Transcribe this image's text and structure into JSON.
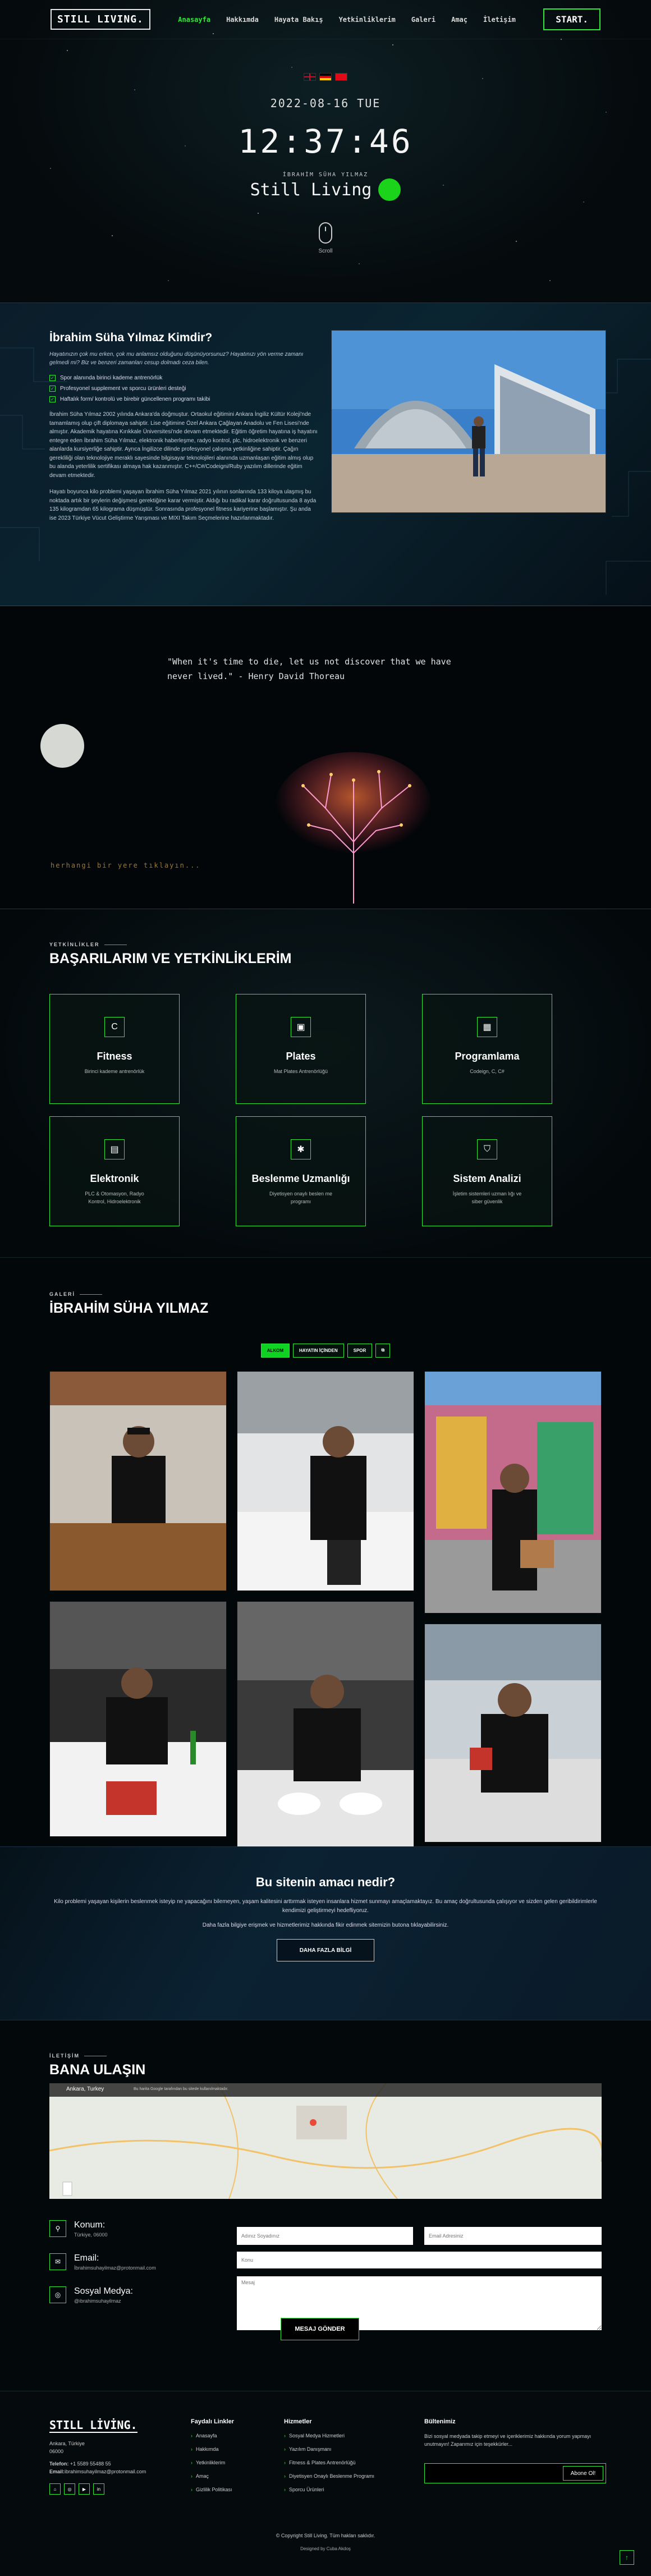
{
  "header": {
    "logo": "STILL LIVING.",
    "nav": [
      "Anasayfa",
      "Hakkımda",
      "Hayata Bakış",
      "Yetkinliklerim",
      "Galeri",
      "Amaç",
      "İletişim"
    ],
    "start": "START."
  },
  "hero": {
    "date": "2022-08-16 TUE",
    "time": "12:37:46",
    "name": "İBRAHİM SÜHA YILMAZ",
    "tagline": "Still Living",
    "scroll": "Scroll"
  },
  "about": {
    "title": "İbrahim Süha Yılmaz Kimdir?",
    "lead": "Hayatınızın çok mu erken, çok mu anlamsız olduğunu düşünüyorsunuz? Hayatınızı yön verme zamanı gelmedi mi? Biz ve benzeri zamanları cesup dolmadı ceza bilen.",
    "checks": [
      "Spor alanında birinci kademe antrenörlük",
      "Profesyonel supplement ve sporcu ürünleri desteği",
      "Haftalık form/ kontrolü ve birebir güncellenen programı takibi"
    ],
    "p1": "İbrahim Süha Yılmaz 2002 yılında Ankara'da doğmuştur. Ortaokul eğitimini Ankara İngiliz Kültür Koleji'nde tamamlamış olup çift diplomaya sahiptir. Lise eğitimine Özel Ankara Çağlayan Anadolu ve Fen Lisesi'nde almıştır. Akademik hayatına Kırıkkale Üniversitesi'nde devam etmektedir. Eğitim öğretim hayatına iş hayatını entegre eden İbrahim Süha Yılmaz, elektronik haberleşme, radyo kontrol, plc, hidroelektronik ve benzeri alanlarda kursiyerliğe sahiptir. Ayrıca İngilizce dilinde profesyonel çalışma yetkinliğine sahiptir. Çağın gerekliliği olan teknolojiye meraklı sayesinde bilgisayar teknolojileri alanında uzmanlaşan eğitim almış olup bu alanda yeterlilik sertifikası almaya hak kazanmıştır. C++/C#/Codeigni/Ruby yazılım dillerinde eğitim devam etmektedir.",
    "p2": "Hayatı boyunca kilo problemi yaşayan İbrahim Süha Yılmaz 2021 yılının sonlarında 133 kiloya ulaşmış bu noktada artık bir şeylerin değişmesi gerektiğine karar vermiştir. Aldığı bu radikal karar doğrultusunda 8 ayda 135 kilogramdan 65 kilograma düşmüştür. Sonrasında profesyonel fitness kariyerine başlamıştır. Şu anda ise 2023 Türkiye Vücut Geliştirme Yarışması ve MIXI Takım Seçmelerine hazırlanmaktadır."
  },
  "quote": {
    "text": "\"When it's time to die, let us not discover that we have never lived.\" - Henry David Thoreau",
    "hint": "herhangi bir yere tıklayın..."
  },
  "skills": {
    "kicker": "YETKİNLİKLER",
    "title": "BAŞARILARIM VE YETKİNLİKLERİM",
    "cards": [
      {
        "icon": "C",
        "title": "Fitness",
        "desc": "Birinci kademe antrenörlük"
      },
      {
        "icon": "▣",
        "title": "Plates",
        "desc": "Mat Plates Antrenörlüğü"
      },
      {
        "icon": "▦",
        "title": "Programlama",
        "desc": "Codeign, C, C#"
      },
      {
        "icon": "▤",
        "title": "Elektronik",
        "desc": "PLC & Otomasyon, Radyo Kontrol, Hidroelektronik"
      },
      {
        "icon": "✱",
        "title": "Beslenme Uzmanlığı",
        "desc": "Diyetisyen onaylı beslen me programı"
      },
      {
        "icon": "⛉",
        "title": "Sistem Analizi",
        "desc": "İşletim sistemleri uzman lığı ve siber güvenlik"
      }
    ]
  },
  "gallery": {
    "kicker": "GALERİ",
    "title": "İBRAHİM SÜHA YILMAZ",
    "tabs": [
      "ALKOM",
      "HAYATIN İÇİNDEN",
      "SPOR",
      "⧉"
    ]
  },
  "mission": {
    "title": "Bu sitenin amacı nedir?",
    "p1": "Kilo problemi yaşayan kişilerin beslenmek isteyip ne yapacağını bilemeyen, yaşam kalitesini arttırmak isteyen insanlara hizmet sunmayı amaçlamaktayız. Bu amaç doğrultusunda çalışıyor ve sizden gelen geribildirimlerle kendimizi geliştirmeyi hedefliyoruz.",
    "p2": "Daha fazla bilgiye erişmek ve hizmetlerimiz hakkında fikir edinmek sitemizin butona tıklayabilirsiniz.",
    "btn": "DAHA FAZLA BİLGİ"
  },
  "contact": {
    "kicker": "İLETİŞİM",
    "title": "BANA ULAŞIN",
    "map_place": "Ankara, Turkey",
    "map_sub": "Bu harita Google tarafından bu sitede kullanılmaktadır.",
    "items": [
      {
        "icon": "⚲",
        "label": "Konum:",
        "value": "Türkiye, 06000"
      },
      {
        "icon": "✉",
        "label": "Email:",
        "value": "İbrahimsuhayilmaz@protonmail.com"
      },
      {
        "icon": "◎",
        "label": "Sosyal Medya:",
        "value": "@ibrahimsuhayilmaz"
      }
    ],
    "ph_name": "Adınız Soyadınız",
    "ph_email": "Email Adresiniz",
    "ph_subject": "Konu",
    "ph_message": "Mesaj",
    "send": "MESAJ GÖNDER"
  },
  "footer": {
    "logo": "STILL LİVİNG.",
    "address1": "Ankara, Türkiye",
    "address2": "06000",
    "phone_label": "Telefon:",
    "phone": "+1 5589 55488 55",
    "email_label": "Email:",
    "email": "ibrahimsuhayilmaz@protonmail.com",
    "col1_title": "Faydalı Linkler",
    "col1": [
      "Anasayfa",
      "Hakkımda",
      "Yetkinliklerim",
      "Amaç",
      "Gizlilik Politikası"
    ],
    "col2_title": "Hizmetler",
    "col2": [
      "Sosyal Medya Hizmetleri",
      "Yazılım Danışmanı",
      "Fitness & Plates Antrenörlüğü",
      "Diyetisyen Onaylı Beslenme Programı",
      "Sporcu Ürünleri"
    ],
    "col3_title": "Bültenimiz",
    "col3_text": "Bizi sosyal medyada takip etmeyi ve içeriklerimiz hakkında yorum yapmayı unutmayın! Zaparımız için teşekkürler...",
    "subscribe": "Abone Ol!",
    "copyright": "© Copyright Still Living. Tüm hakları saklıdır.",
    "designed": "Designed by Cuba Akdoş"
  }
}
